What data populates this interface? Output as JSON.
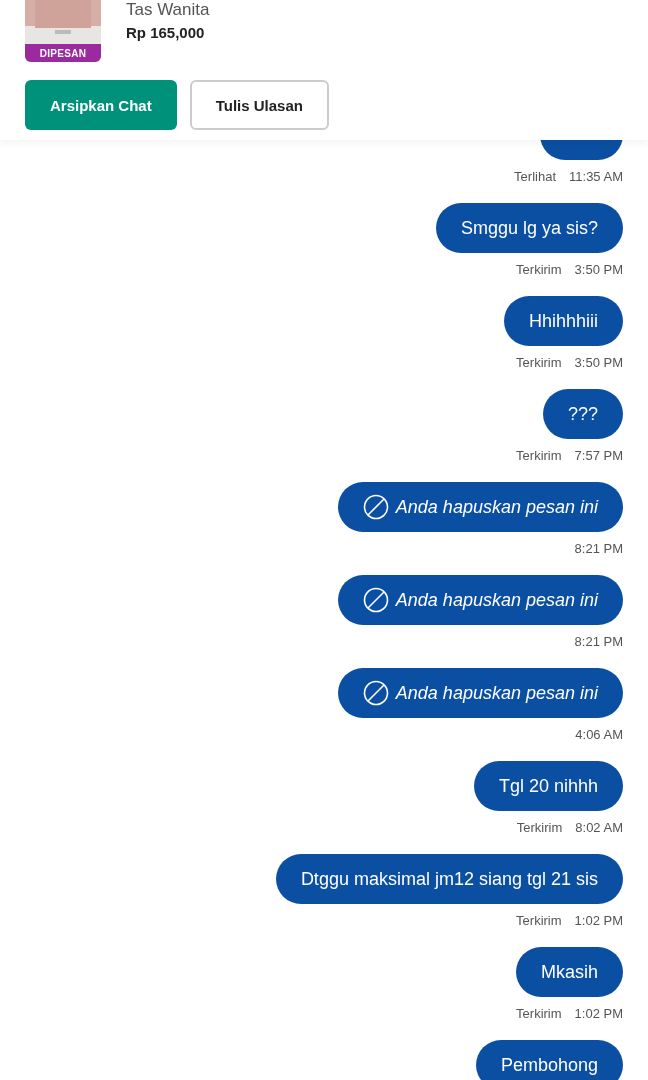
{
  "product": {
    "name": "Tas Wanita",
    "price": "Rp 165,000",
    "badge": "DIPESAN"
  },
  "actions": [
    {
      "label": "Arsipkan Chat",
      "kind": "primary"
    },
    {
      "label": "Tulis Ulasan",
      "kind": "outline"
    }
  ],
  "messages": [
    {
      "kind": "cut",
      "status": "Terlihat",
      "time": "11:35 AM"
    },
    {
      "kind": "text",
      "text": "Smggu lg ya sis?",
      "status": "Terkirim",
      "time": "3:50 PM"
    },
    {
      "kind": "text",
      "text": "Hhihhhiii",
      "status": "Terkirim",
      "time": "3:50 PM"
    },
    {
      "kind": "text",
      "text": "???",
      "status": "Terkirim",
      "time": "7:57 PM"
    },
    {
      "kind": "deleted",
      "text": "Anda hapuskan pesan ini",
      "time": "8:21 PM"
    },
    {
      "kind": "deleted",
      "text": "Anda hapuskan pesan ini",
      "time": "8:21 PM"
    },
    {
      "kind": "deleted",
      "text": "Anda hapuskan pesan ini",
      "time": "4:06 AM"
    },
    {
      "kind": "text",
      "text": "Tgl 20 nihhh",
      "status": "Terkirim",
      "time": "8:02 AM"
    },
    {
      "kind": "text",
      "text": "Dtggu maksimal jm12 siang tgl 21 sis",
      "status": "Terkirim",
      "time": "1:02 PM"
    },
    {
      "kind": "text",
      "text": "Mkasih",
      "status": "Terkirim",
      "time": "1:02 PM"
    },
    {
      "kind": "text",
      "text": "Pembohong"
    }
  ]
}
